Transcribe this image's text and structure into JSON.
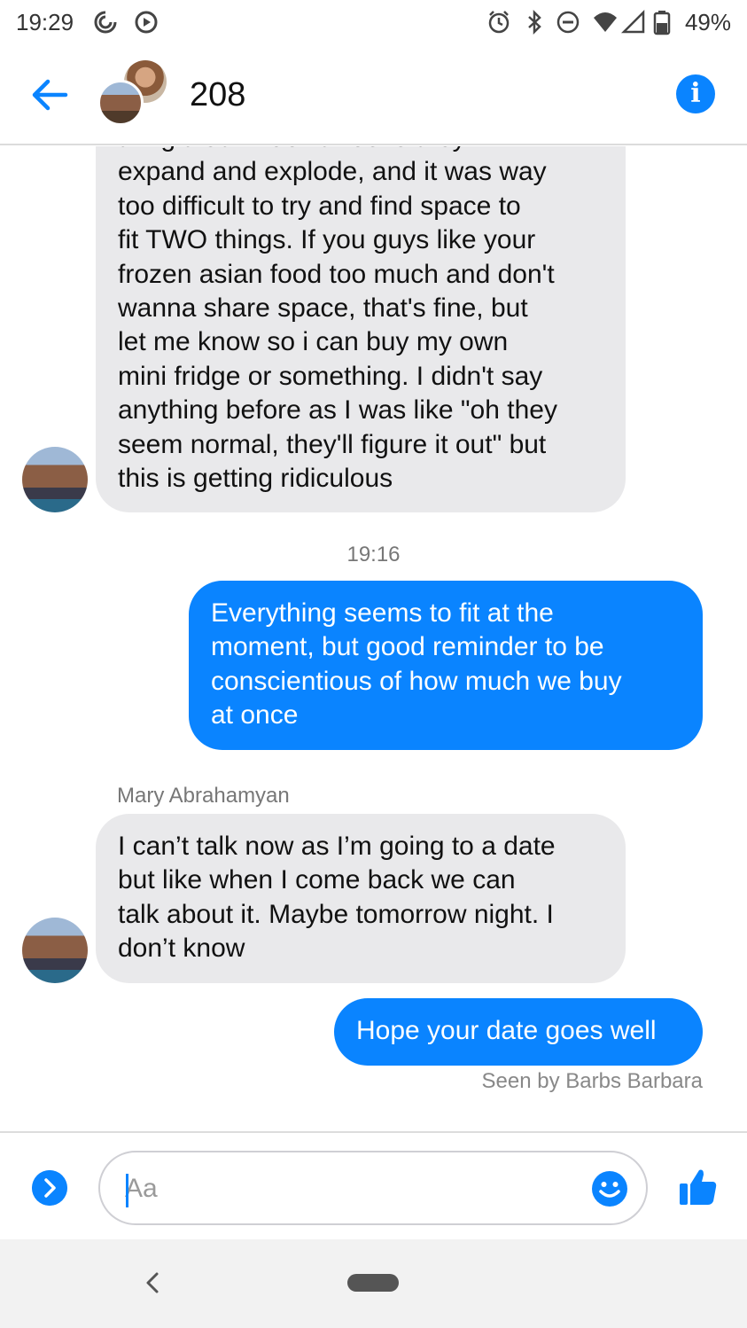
{
  "status_bar": {
    "time": "19:29",
    "battery": "49%",
    "icons": [
      "vpn-key-icon",
      "play-circle-icon",
      "alarm-icon",
      "bluetooth-icon",
      "do-not-disturb-icon",
      "wifi-icon",
      "cell-signal-icon",
      "battery-icon"
    ]
  },
  "header": {
    "title": "208",
    "back_icon": "arrow-left-icon",
    "info_icon": "info-icon",
    "info_glyph": "i"
  },
  "messages": [
    {
      "direction": "incoming",
      "lines": [
        "thing that if I don't freeze they will",
        "expand and explode, and it was way",
        "too difficult to try and find space to",
        "fit TWO things. If you guys like your",
        "frozen asian food too much and don't",
        "wanna share space, that's fine, but",
        "let me know so i can buy my own",
        "mini fridge or something. I didn't say",
        "anything before as I was like \"oh they",
        "seem normal, they'll figure it out\" but",
        "this is getting ridiculous"
      ]
    },
    {
      "timestamp": "19:16"
    },
    {
      "direction": "outgoing",
      "lines": [
        "Everything seems to fit at the",
        "moment, but good reminder to be",
        "conscientious of how much we buy",
        "at once"
      ]
    },
    {
      "sender": "Mary Abrahamyan"
    },
    {
      "direction": "incoming",
      "lines": [
        "I can’t talk now as I’m going to a date",
        "but like when I come back we can",
        "talk about it. Maybe tomorrow night. I",
        "don’t know"
      ]
    },
    {
      "direction": "outgoing",
      "lines": [
        "Hope your date goes well"
      ]
    }
  ],
  "seen_text": "Seen by Barbs Barbara",
  "composer": {
    "placeholder": "Aa",
    "value": "",
    "expand_icon": "chevron-right-icon",
    "emoji_icon": "emoji-icon",
    "like_icon": "thumbs-up-icon"
  },
  "navbar": {
    "back_icon": "nav-back-icon",
    "home_icon": "home-pill-icon"
  },
  "colors": {
    "accent": "#0a84ff",
    "incoming_bubble": "#e9e9eb"
  }
}
